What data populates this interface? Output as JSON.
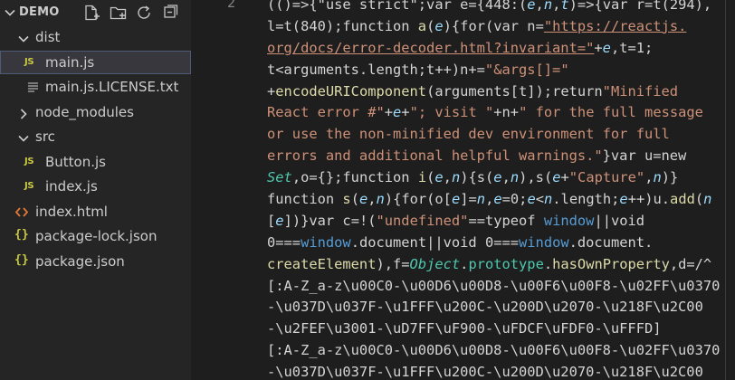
{
  "explorer": {
    "project_title": "DEMO",
    "actions": [
      "new-file",
      "new-folder",
      "refresh",
      "collapse-all"
    ],
    "items": [
      {
        "label": "dist",
        "kind": "folder",
        "expanded": true,
        "depth": 1
      },
      {
        "label": "main.js",
        "kind": "js",
        "badge": "JS",
        "depth": 2,
        "selected": true
      },
      {
        "label": "main.js.LICENSE.txt",
        "kind": "text",
        "depth": 2
      },
      {
        "label": "node_modules",
        "kind": "folder",
        "expanded": false,
        "depth": 1
      },
      {
        "label": "src",
        "kind": "folder",
        "expanded": true,
        "depth": 1
      },
      {
        "label": "Button.js",
        "kind": "js",
        "badge": "JS",
        "depth": 2
      },
      {
        "label": "index.js",
        "kind": "js",
        "badge": "JS",
        "depth": 2
      },
      {
        "label": "index.html",
        "kind": "html",
        "badge": "<>",
        "depth": 1
      },
      {
        "label": "package-lock.json",
        "kind": "json",
        "badge": "{}",
        "depth": 1
      },
      {
        "label": "package.json",
        "kind": "json",
        "badge": "{}",
        "depth": 1
      }
    ]
  },
  "editor": {
    "line_number": "2",
    "code_lines": [
      [
        [
          "p",
          "(()=>{\"use strict\";var e={448:("
        ],
        [
          "v",
          "e"
        ],
        [
          "p",
          ","
        ],
        [
          "v",
          "n"
        ],
        [
          "p",
          ","
        ],
        [
          "v",
          "t"
        ],
        [
          "p",
          ")=>{var r=t(294),"
        ]
      ],
      [
        [
          "p",
          "l=t(840);function "
        ],
        [
          "f",
          "a"
        ],
        [
          "p",
          "("
        ],
        [
          "v",
          "e"
        ],
        [
          "p",
          "){for(var n="
        ],
        [
          "l",
          "\"https://reactjs."
        ]
      ],
      [
        [
          "l",
          "org/docs/error-decoder.html?invariant=\""
        ],
        [
          "p",
          "+"
        ],
        [
          "v",
          "e"
        ],
        [
          "p",
          ",t=1;"
        ]
      ],
      [
        [
          "p",
          "t<arguments.length;t++)n+="
        ],
        [
          "s",
          "\"&args[]=\""
        ]
      ],
      [
        [
          "p",
          "+"
        ],
        [
          "f",
          "encodeURIComponent"
        ],
        [
          "p",
          "(arguments[t]);return"
        ],
        [
          "s",
          "\"Minified"
        ]
      ],
      [
        [
          "s",
          "React error #\""
        ],
        [
          "p",
          "+"
        ],
        [
          "v",
          "e"
        ],
        [
          "p",
          "+"
        ],
        [
          "s",
          "\"; visit \""
        ],
        [
          "p",
          "+n+"
        ],
        [
          "s",
          "\" for the full message"
        ]
      ],
      [
        [
          "s",
          "or use the non-minified dev environment for full"
        ]
      ],
      [
        [
          "s",
          "errors and additional helpful warnings.\""
        ],
        [
          "p",
          "}var u=new"
        ]
      ],
      [
        [
          "y",
          "Set"
        ],
        [
          "p",
          ",o={};function "
        ],
        [
          "f",
          "i"
        ],
        [
          "p",
          "("
        ],
        [
          "v",
          "e"
        ],
        [
          "p",
          ","
        ],
        [
          "v",
          "n"
        ],
        [
          "p",
          "){s("
        ],
        [
          "v",
          "e"
        ],
        [
          "p",
          ","
        ],
        [
          "v",
          "n"
        ],
        [
          "p",
          "),s("
        ],
        [
          "v",
          "e"
        ],
        [
          "p",
          "+"
        ],
        [
          "s",
          "\"Capture\""
        ],
        [
          "p",
          ","
        ],
        [
          "v",
          "n"
        ],
        [
          "p",
          ")}"
        ]
      ],
      [
        [
          "p",
          "function "
        ],
        [
          "f",
          "s"
        ],
        [
          "p",
          "("
        ],
        [
          "v",
          "e"
        ],
        [
          "p",
          ","
        ],
        [
          "v",
          "n"
        ],
        [
          "p",
          "){for(o["
        ],
        [
          "v",
          "e"
        ],
        [
          "p",
          "]="
        ],
        [
          "v",
          "n"
        ],
        [
          "p",
          ","
        ],
        [
          "v",
          "e"
        ],
        [
          "p",
          "=0;"
        ],
        [
          "v",
          "e"
        ],
        [
          "p",
          "<"
        ],
        [
          "v",
          "n"
        ],
        [
          "p",
          ".length;"
        ],
        [
          "v",
          "e"
        ],
        [
          "p",
          "++)u."
        ],
        [
          "f",
          "add"
        ],
        [
          "p",
          "("
        ],
        [
          "v",
          "n"
        ]
      ],
      [
        [
          "p",
          "["
        ],
        [
          "v",
          "e"
        ],
        [
          "p",
          "])}var c=!("
        ],
        [
          "s",
          "\"undefined\""
        ],
        [
          "p",
          "==typeof "
        ],
        [
          "k",
          "window"
        ],
        [
          "p",
          "||void"
        ]
      ],
      [
        [
          "p",
          "0==="
        ],
        [
          "k",
          "window"
        ],
        [
          "p",
          ".document||void 0==="
        ],
        [
          "k",
          "window"
        ],
        [
          "p",
          ".document."
        ]
      ],
      [
        [
          "f",
          "createElement"
        ],
        [
          "p",
          "),f="
        ],
        [
          "y",
          "Object"
        ],
        [
          "p",
          "."
        ],
        [
          "t",
          "prototype"
        ],
        [
          "p",
          "."
        ],
        [
          "f",
          "hasOwnProperty"
        ],
        [
          "p",
          ",d=/^"
        ]
      ],
      [
        [
          "p",
          "[:A-Z_a-z\\u00C0-\\u00D6\\u00D8-\\u00F6\\u00F8-\\u02FF\\u0370"
        ]
      ],
      [
        [
          "p",
          "-\\u037D\\u037F-\\u1FFF\\u200C-\\u200D\\u2070-\\u218F\\u2C00"
        ]
      ],
      [
        [
          "p",
          "-\\u2FEF\\u3001-\\uD7FF\\uF900-\\uFDCF\\uFDF0-\\uFFFD]"
        ]
      ],
      [
        [
          "p",
          "[:A-Z_a-z\\u00C0-\\u00D6\\u00D8-\\u00F6\\u00F8-\\u02FF\\u0370"
        ]
      ],
      [
        [
          "p",
          "-\\u037D\\u037F-\\u1FFF\\u200C-\\u200D\\u2070-\\u218F\\u2C00"
        ]
      ]
    ]
  },
  "colors": {
    "sidebar_bg": "#252526",
    "editor_bg": "#1e1e1e",
    "selected_row_bg": "#37373d",
    "js_badge": "#cbcb41",
    "html_icon": "#e37933",
    "string": "#ce9178",
    "function": "#dcdcaa",
    "variable": "#9cdcfe",
    "keyword": "#569cd6",
    "type": "#4ec9b0"
  }
}
